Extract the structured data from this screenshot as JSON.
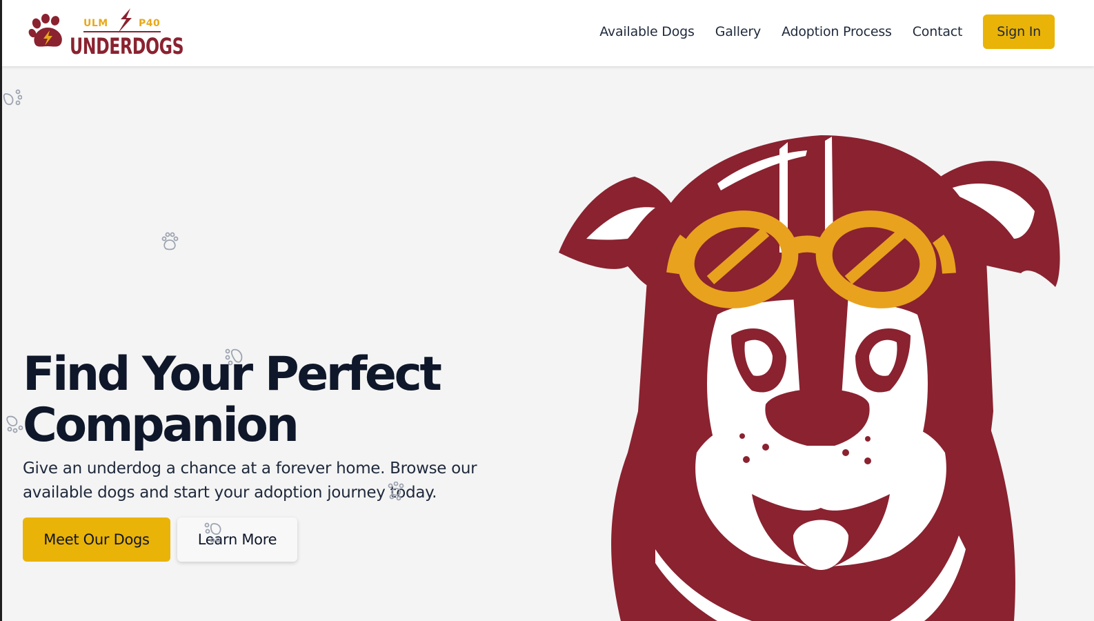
{
  "brand": {
    "tag_left": "ULM",
    "tag_right": "P40",
    "name": "UNDERDOGS",
    "logo_icon": "paw-bolt-icon",
    "colors": {
      "maroon": "#8a2230",
      "gold": "#e8a91a"
    }
  },
  "nav": {
    "links": [
      "Available Dogs",
      "Gallery",
      "Adoption Process",
      "Contact"
    ],
    "sign_in": "Sign In"
  },
  "hero": {
    "headline_line1": "Find Your Perfect",
    "headline_line2": "Companion",
    "subtext_line1": "Give an underdog a chance at a forever home. Browse our",
    "subtext_line2": "available dogs and start your adoption journey today.",
    "primary_cta": "Meet Our Dogs",
    "secondary_cta": "Learn More",
    "illustration": "dog-mascot-with-goggles",
    "decoration_icon": "paw-print-icon"
  },
  "colors": {
    "accent": "#eab308",
    "text_dark": "#0f172a",
    "background": "#f4f4f4",
    "mascot_maroon": "#8a2230",
    "goggle_gold": "#e8a21e"
  }
}
